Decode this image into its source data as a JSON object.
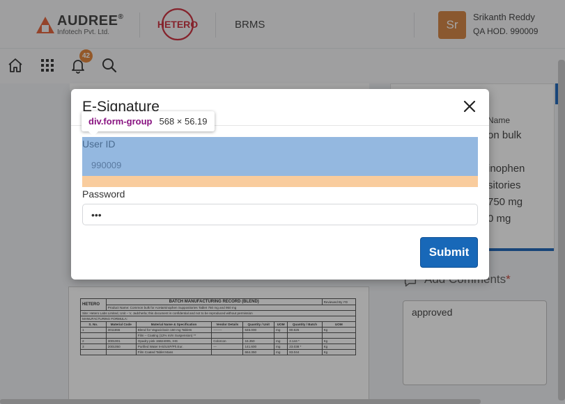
{
  "header": {
    "company_name": "AUDREE",
    "company_reg": "®",
    "company_sub": "Infotech Pvt. Ltd.",
    "partner_logo_text": "HETERO",
    "app_name": "BRMS",
    "user": {
      "initials": "Sr",
      "name": "Srikanth Reddy",
      "role": "QA HOD. 990009"
    }
  },
  "toolbar": {
    "notification_count": "42"
  },
  "background": {
    "doc_title": "BATCH MANUFACTURING RECORD (BLEND)",
    "doc_product": "Product Name: Common bulk for Acetaminophen Suppositories Tablet 750 mg and 950 mg",
    "doc_reviewed": "Reviewed By I*D",
    "doc_site": "Site: Hetero Labs Limited, Unit – V, Jadcherla; this document is confidential and not to be reproduced without permission",
    "doc_formula": "MANUFACTURING FORMULA:",
    "doc_columns": [
      "S. No.",
      "Material Code",
      "Material Name & Specification",
      "Vendor Details",
      "Quantity / Unit",
      "UOM",
      "Quantity / Batch",
      "UOM"
    ],
    "doc_rows": [
      [
        "1",
        "3011555",
        "Blend for Vagacicloxin 150 mg Tablets",
        "--------",
        "645.000",
        "mg",
        "80.625",
        "Kg"
      ],
      [
        "",
        "",
        "Film – Coating (12% m/m Suspension) **",
        "",
        "",
        "",
        "",
        ""
      ],
      [
        "2",
        "3001001",
        "Opadry pink 15B24005, IHS",
        "Colorcon",
        "16.350",
        "mg",
        "2.144 *",
        "Kg"
      ],
      [
        "3",
        "2001050",
        "Purified Water IHS/USP/Ph.Eur.",
        "---",
        "141.600",
        "mg",
        "23.038 *",
        "Kg"
      ],
      [
        "",
        "",
        "Film Coated Tablet Mass",
        "",
        "664.350",
        "mg",
        "83.044",
        "Kg"
      ]
    ],
    "right_card_lines": [
      "Name",
      "on bulk",
      "inophen",
      "sitories",
      "750 mg",
      "0 mg"
    ],
    "comments_label": "Add Comments",
    "comments_required": "*",
    "comments_value": "approved"
  },
  "modal": {
    "title": "E-Signature",
    "userid_label": "User ID",
    "userid_value": "990009",
    "password_label": "Password",
    "password_value": "•••",
    "submit_label": "Submit"
  },
  "devtools_tooltip": {
    "tag": "div.form-group",
    "dims": "568 × 56.19"
  },
  "colors": {
    "primary": "#1868b8",
    "accent": "#e07b2a",
    "hetero_red": "#c8202f",
    "audree_orange": "#e2572b"
  }
}
